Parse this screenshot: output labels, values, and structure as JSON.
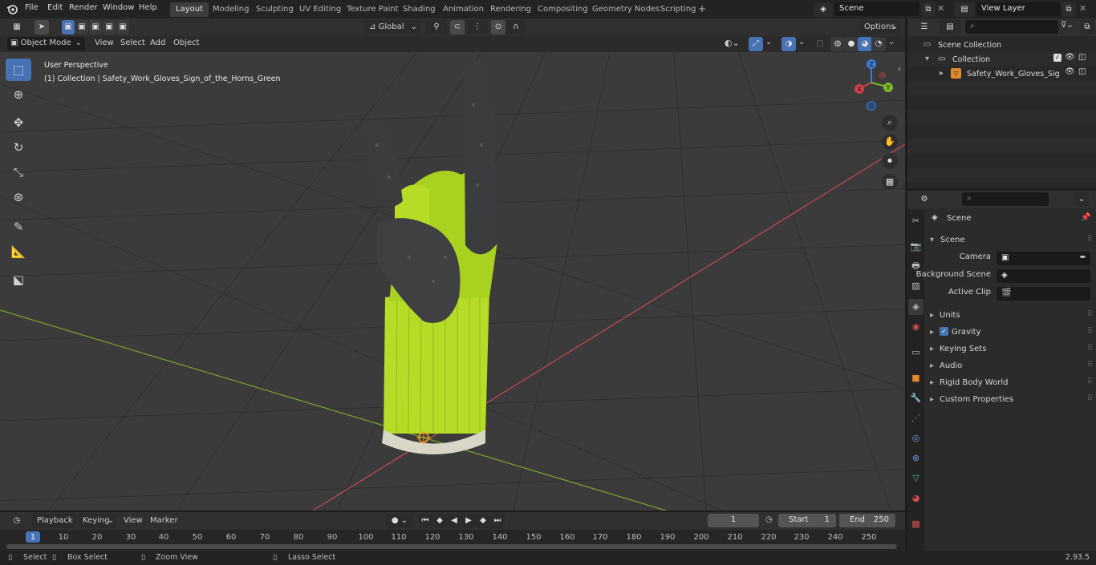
{
  "topbar": {
    "menus": [
      "File",
      "Edit",
      "Render",
      "Window",
      "Help"
    ],
    "workspace_tabs": [
      "Layout",
      "Modeling",
      "Sculpting",
      "UV Editing",
      "Texture Paint",
      "Shading",
      "Animation",
      "Rendering",
      "Compositing",
      "Geometry Nodes",
      "Scripting"
    ],
    "active_tab": "Layout",
    "add_tab_label": "+",
    "scene_value": "Scene",
    "view_layer_value": "View Layer"
  },
  "viewport_header": {
    "mode": "Object Mode",
    "menus": [
      "View",
      "Select",
      "Add",
      "Object"
    ],
    "orientation": "Global",
    "options_label": "Options"
  },
  "viewport": {
    "perspective_label": "User Perspective",
    "collection_label": "(1) Collection | Safety_Work_Gloves_Sign_of_the_Horns_Green",
    "gizmo": {
      "x": "X",
      "y": "Y",
      "z": "Z"
    },
    "colors": {
      "grid_bg": "#3a3a3a",
      "x_axis": "#c04850",
      "y_axis": "#7aa02c",
      "glove_green": "#b6dc28",
      "glove_coating": "#3a3c3e",
      "active_blue": "#4772b3"
    }
  },
  "outliner": {
    "scene_collection": "Scene Collection",
    "collection": "Collection",
    "object": "Safety_Work_Gloves_Sig"
  },
  "properties": {
    "header_title": "Scene",
    "section": "Scene",
    "camera_label": "Camera",
    "background_scene_label": "Background Scene",
    "active_clip_label": "Active Clip",
    "panels": [
      "Units",
      "Gravity",
      "Keying Sets",
      "Audio",
      "Rigid Body World",
      "Custom Properties"
    ]
  },
  "timeline": {
    "menus": [
      "Playback",
      "Keying",
      "View",
      "Marker"
    ],
    "current_frame": "1",
    "start_label": "Start",
    "start_value": "1",
    "end_label": "End",
    "end_value": "250",
    "ruler_ticks": [
      "1",
      "10",
      "20",
      "30",
      "40",
      "50",
      "60",
      "70",
      "80",
      "90",
      "100",
      "110",
      "120",
      "130",
      "140",
      "150",
      "160",
      "170",
      "180",
      "190",
      "200",
      "210",
      "220",
      "230",
      "240",
      "250"
    ]
  },
  "statusbar": {
    "select": "Select",
    "box_select": "Box Select",
    "zoom_view": "Zoom View",
    "lasso_select": "Lasso Select",
    "version": "2.93.5"
  }
}
